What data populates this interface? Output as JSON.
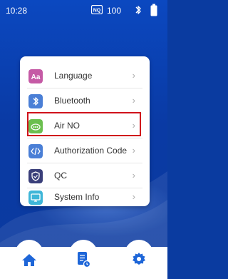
{
  "status_bar": {
    "time": "10:28",
    "nq_badge_icon": "nq-icon",
    "battery_percent": "100",
    "bluetooth_icon": "bluetooth-icon",
    "battery_icon": "battery-icon"
  },
  "menu": {
    "items": [
      {
        "label": "Language",
        "icon": "language-icon",
        "color": "#c55aa5"
      },
      {
        "label": "Bluetooth",
        "icon": "bluetooth-icon",
        "color": "#4a7fd6"
      },
      {
        "label": "Air NO",
        "icon": "air-no-icon",
        "color": "#6bbf4f"
      },
      {
        "label": "Authorization Code",
        "icon": "code-icon",
        "color": "#4a7fd6"
      },
      {
        "label": "QC",
        "icon": "shield-icon",
        "color": "#3a3f7a"
      },
      {
        "label": "System Info",
        "icon": "system-info-icon",
        "color": "#3fb6d8"
      }
    ],
    "highlighted_item": "Authorization Code",
    "highlight_color": "#d0121b"
  },
  "bottom_nav": {
    "items": [
      {
        "icon": "home-icon",
        "color": "#1e66d8"
      },
      {
        "icon": "records-icon",
        "color": "#1e66d8"
      },
      {
        "icon": "settings-icon",
        "color": "#1e66d8"
      }
    ]
  }
}
